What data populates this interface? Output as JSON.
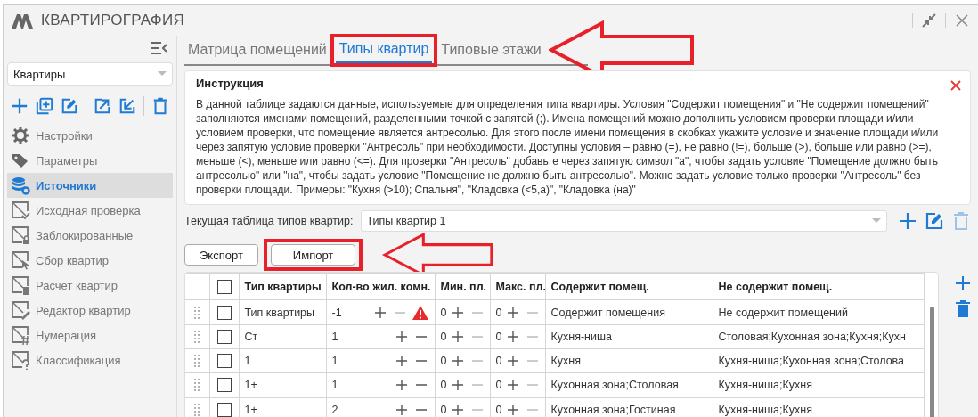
{
  "window": {
    "title": "КВАРТИРОГРАФИЯ"
  },
  "sidebar": {
    "selector": {
      "value": "Квартиры"
    },
    "items": [
      {
        "label": "Настройки",
        "kind": "settings",
        "selected": false
      },
      {
        "label": "Параметры",
        "kind": "parameters",
        "selected": false
      },
      {
        "label": "Источники",
        "kind": "sources",
        "selected": true
      },
      {
        "label": "Исходная проверка",
        "kind": "check",
        "selected": false
      },
      {
        "label": "Заблокированные",
        "kind": "locked",
        "selected": false
      },
      {
        "label": "Сбор квартир",
        "kind": "collect",
        "selected": false
      },
      {
        "label": "Расчет квартир",
        "kind": "calc",
        "selected": false
      },
      {
        "label": "Редактор квартир",
        "kind": "edit",
        "selected": false
      },
      {
        "label": "Нумерация",
        "kind": "numbering",
        "selected": false
      },
      {
        "label": "Классификация",
        "kind": "classify",
        "selected": false
      }
    ]
  },
  "tabs": [
    {
      "label": "Матрица помещений",
      "selected": false,
      "highlighted": false
    },
    {
      "label": "Типы квартир",
      "selected": true,
      "highlighted": true
    },
    {
      "label": "Типовые этажи",
      "selected": false,
      "highlighted": false
    }
  ],
  "instruction": {
    "title": "Инструкция",
    "text": "В данной таблице задаются данные, используемые для определения типа квартиры. Условия \"Содержит помещения\" и \"Не содержит помещений\" заполняются именами помещений, разделенными точкой с запятой (;). Имена помещений можно дополнить условием проверки площади и/или условием проверки, что помещение является антресолью. Для этого после имени помещения в скобках укажите условие и значение площади и/или через запятую условие проверки \"Антресоль\" при необходимости. Доступны условия – равно (=), не равно (!=), больше (>), больше или равно (>=), меньше (<), меньше или равно (<=). Для проверки \"Антресоль\" добавьте через запятую символ \"а\", чтобы задать условие \"Помещение должно быть антресолью\" или \"на\", чтобы задать условие \"Помещение не должно быть антресолью\". Можно задать условие только проверки \"Антресоль\" без проверки площади. Примеры: \"Кухня (>10); Спальня\", \"Кладовка (<5,а)\", \"Кладовка (на)\""
  },
  "current_table": {
    "label": "Текущая таблица типов квартир:",
    "value": "Типы квартир 1"
  },
  "buttons": [
    {
      "label": "Экспорт",
      "highlighted": false
    },
    {
      "label": "Импорт",
      "highlighted": true
    }
  ],
  "table": {
    "select_all_checked": false,
    "columns": [
      "Тип квартиры",
      "Кол-во жил. комн.",
      "Мин. пл.",
      "Макс. пл.",
      "Содержит помещ.",
      "Не содержит помещ."
    ],
    "rows": [
      {
        "checked": false,
        "type": "Тип квартиры",
        "rooms": {
          "value": "-1",
          "minus_disabled": true,
          "warning": true
        },
        "min": {
          "value": "0",
          "minus_disabled": true
        },
        "max": {
          "value": "0",
          "minus_disabled": true
        },
        "contains": "Содержит помещения",
        "excludes": "Не содержит помещений"
      },
      {
        "checked": false,
        "type": "Ст",
        "rooms": {
          "value": "1",
          "minus_disabled": false,
          "warning": false
        },
        "min": {
          "value": "0",
          "minus_disabled": true
        },
        "max": {
          "value": "0",
          "minus_disabled": true
        },
        "contains": "Кухня-ниша",
        "excludes": "Столовая;Кухонная зона;Кухня;Кухн"
      },
      {
        "checked": false,
        "type": "1",
        "rooms": {
          "value": "1",
          "minus_disabled": false,
          "warning": false
        },
        "min": {
          "value": "0",
          "minus_disabled": true
        },
        "max": {
          "value": "0",
          "minus_disabled": true
        },
        "contains": "Кухня",
        "excludes": "Кухня-ниша;Кухонная зона;Столова"
      },
      {
        "checked": false,
        "type": "1+",
        "rooms": {
          "value": "1",
          "minus_disabled": false,
          "warning": false
        },
        "min": {
          "value": "0",
          "minus_disabled": true
        },
        "max": {
          "value": "0",
          "minus_disabled": true
        },
        "contains": "Кухонная зона;Столовая",
        "excludes": "Кухня-ниша;Кухня"
      },
      {
        "checked": false,
        "type": "1+",
        "rooms": {
          "value": "2",
          "minus_disabled": false,
          "warning": false
        },
        "min": {
          "value": "0",
          "minus_disabled": true
        },
        "max": {
          "value": "0",
          "minus_disabled": true
        },
        "contains": "Кухонная зона;Гостиная",
        "excludes": "Кухня-ниша;Кухня"
      }
    ]
  }
}
